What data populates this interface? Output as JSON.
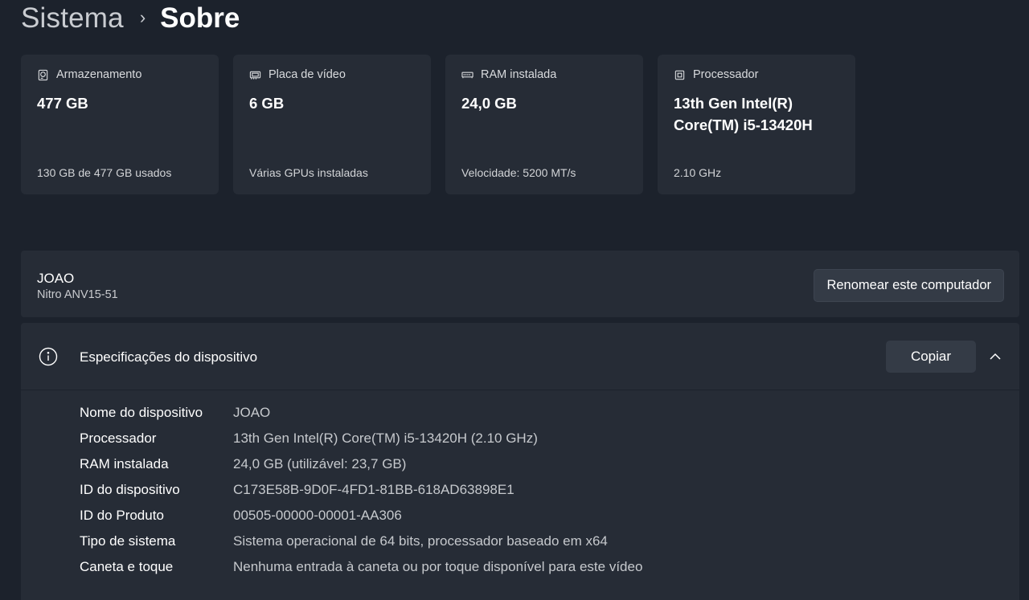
{
  "breadcrumb": {
    "parent": "Sistema",
    "separator": "›",
    "current": "Sobre"
  },
  "cards": [
    {
      "icon": "storage-icon",
      "label": "Armazenamento",
      "value": "477 GB",
      "sub": "130 GB de 477 GB usados"
    },
    {
      "icon": "gpu-icon",
      "label": "Placa de vídeo",
      "value": "6 GB",
      "sub": "Várias GPUs instaladas"
    },
    {
      "icon": "ram-icon",
      "label": "RAM instalada",
      "value": "24,0 GB",
      "sub": "Velocidade: 5200 MT/s"
    },
    {
      "icon": "processor-icon",
      "label": "Processador",
      "value_line1": "13th Gen Intel(R)",
      "value_line2": "Core(TM) i5-13420H",
      "sub": "2.10 GHz"
    }
  ],
  "computer": {
    "name": "JOAO",
    "model": "Nitro ANV15-51",
    "rename_label": "Renomear este computador"
  },
  "specs": {
    "title": "Especificações do dispositivo",
    "copy_label": "Copiar",
    "rows": [
      {
        "label": "Nome do dispositivo",
        "value": "JOAO"
      },
      {
        "label": "Processador",
        "value": "13th Gen Intel(R) Core(TM) i5-13420H (2.10 GHz)"
      },
      {
        "label": "RAM instalada",
        "value": "24,0 GB (utilizável: 23,7 GB)"
      },
      {
        "label": "ID do dispositivo",
        "value": "C173E58B-9D0F-4FD1-81BB-618AD63898E1"
      },
      {
        "label": "ID do Produto",
        "value": "00505-00000-00001-AA306"
      },
      {
        "label": "Tipo de sistema",
        "value": "Sistema operacional de 64 bits, processador baseado em x64"
      },
      {
        "label": "Caneta e toque",
        "value": "Nenhuma entrada à caneta ou por toque disponível para este vídeo"
      }
    ]
  },
  "colors": {
    "background": "#1c222c",
    "card": "#262c36",
    "button": "#343b46"
  }
}
